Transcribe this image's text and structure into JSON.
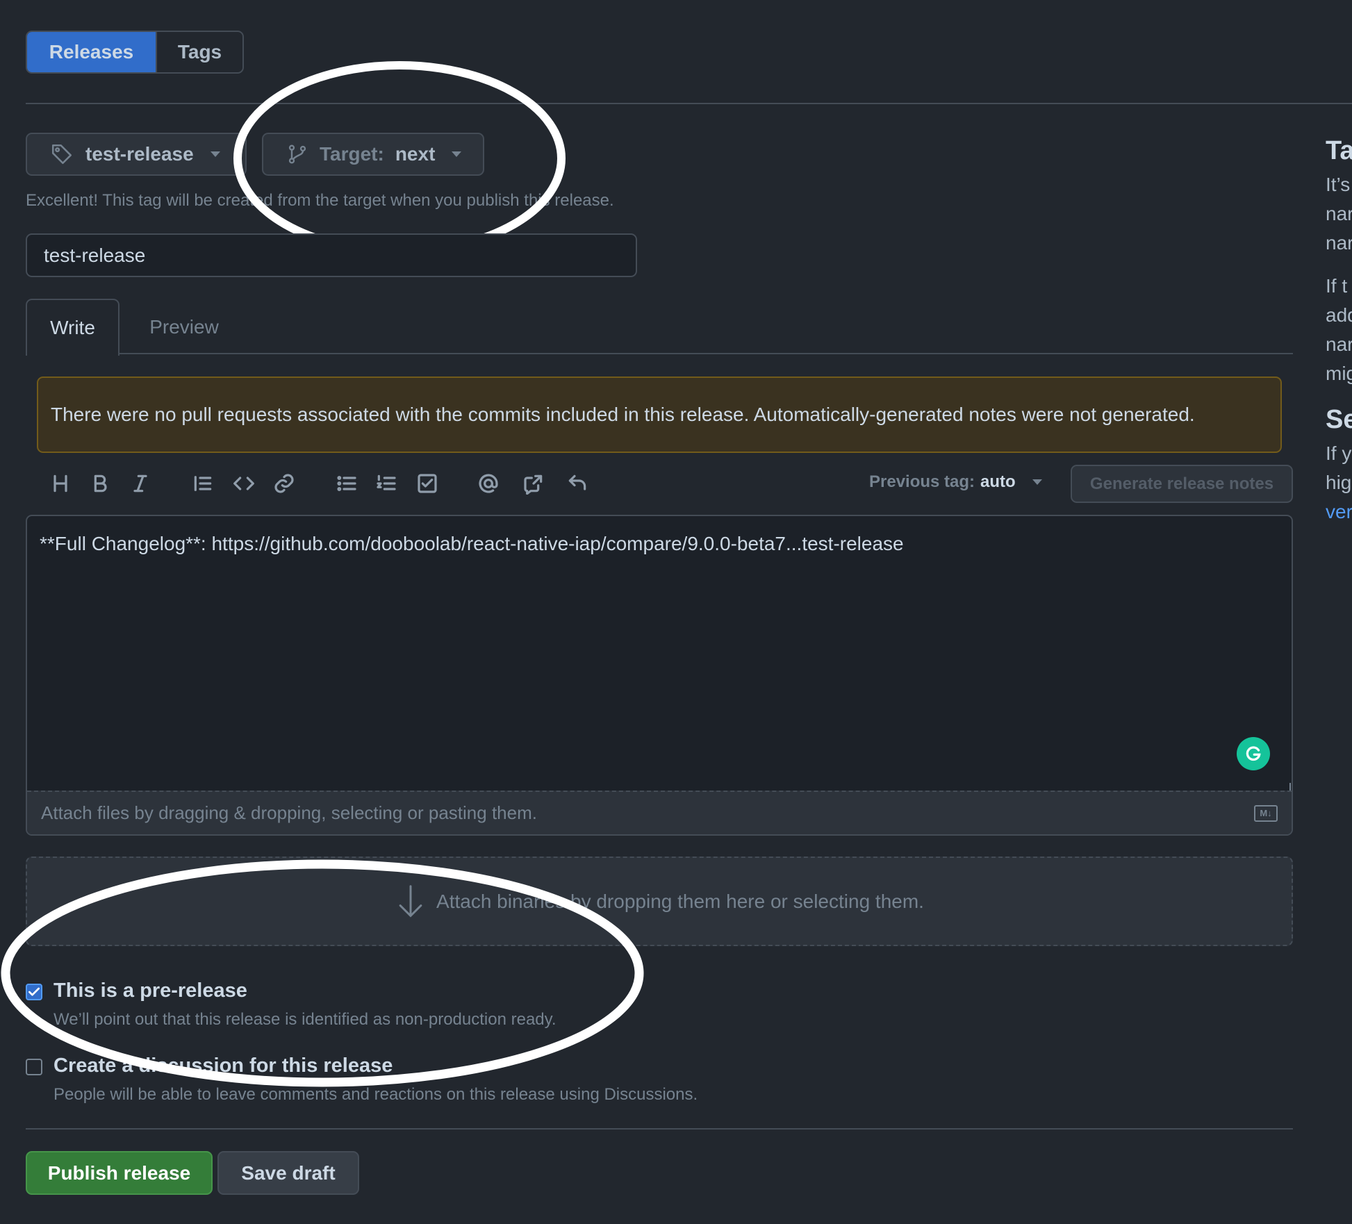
{
  "nav": {
    "releases_label": "Releases",
    "tags_label": "Tags"
  },
  "tag_picker": {
    "value": "test-release",
    "icon": "tag-icon"
  },
  "target_picker": {
    "label": "Target:",
    "value": "next",
    "icon": "git-branch-icon"
  },
  "tag_hint": "Excellent! This tag will be created from the target when you publish this release.",
  "title_input": {
    "value": "test-release"
  },
  "editor_tabs": {
    "write": "Write",
    "preview": "Preview"
  },
  "flash_warning": "There were no pull requests associated with the commits included in this release. Automatically-generated notes were not generated.",
  "toolbar": {
    "previous_tag_label": "Previous tag:",
    "previous_tag_value": "auto",
    "generate_button": "Generate release notes",
    "icons": [
      "heading-icon",
      "bold-icon",
      "italic-icon",
      "quote-icon",
      "code-icon",
      "link-icon",
      "unordered-list-icon",
      "ordered-list-icon",
      "task-list-icon",
      "mention-icon",
      "cross-reference-icon",
      "reply-icon"
    ]
  },
  "editor": {
    "content": "**Full Changelog**: https://github.com/dooboolab/react-native-iap/compare/9.0.0-beta7...test-release",
    "footer_hint": "Attach files by dragging & dropping, selecting or pasting them."
  },
  "dropzone": {
    "text": "Attach binaries by dropping them here or selecting them."
  },
  "prerelease": {
    "label": "This is a pre-release",
    "note": "We’ll point out that this release is identified as non-production ready.",
    "checked": true
  },
  "discussion": {
    "label": "Create a discussion for this release",
    "note": "People will be able to leave comments and reactions on this release using Discussions.",
    "checked": false
  },
  "actions": {
    "publish": "Publish release",
    "save_draft": "Save draft"
  },
  "sidebar": {
    "heading1": "Ta",
    "lines1": [
      "It’s",
      "nar",
      "nar"
    ],
    "lines2": [
      "If t",
      "add",
      "nar",
      "mig"
    ],
    "heading2": "Se",
    "lines3": [
      "If y",
      "hig"
    ],
    "link": "ver"
  },
  "colors": {
    "accent": "#316dca",
    "publish": "#347d39",
    "warning_bg": "#3a3220",
    "link": "#539bf5"
  }
}
